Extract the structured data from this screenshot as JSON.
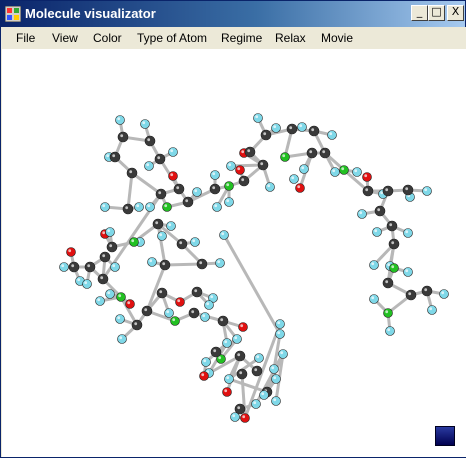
{
  "window": {
    "title": "Molecule visualizator",
    "controls": {
      "minimize": "_",
      "maximize": "□",
      "close": "X"
    }
  },
  "menu": {
    "items": [
      "File",
      "View",
      "Color",
      "Type of Atom",
      "Regime",
      "Relax",
      "Movie"
    ]
  },
  "colors": {
    "carbon": "#3a3a3a",
    "hydrogen": "#7fd8e8",
    "nitrogen": "#22c022",
    "oxygen": "#e01010",
    "bond": "#b8b8b8"
  },
  "icons": [
    "app-icon",
    "minimize-icon",
    "maximize-icon",
    "close-icon",
    "color-swatch-icon"
  ]
}
